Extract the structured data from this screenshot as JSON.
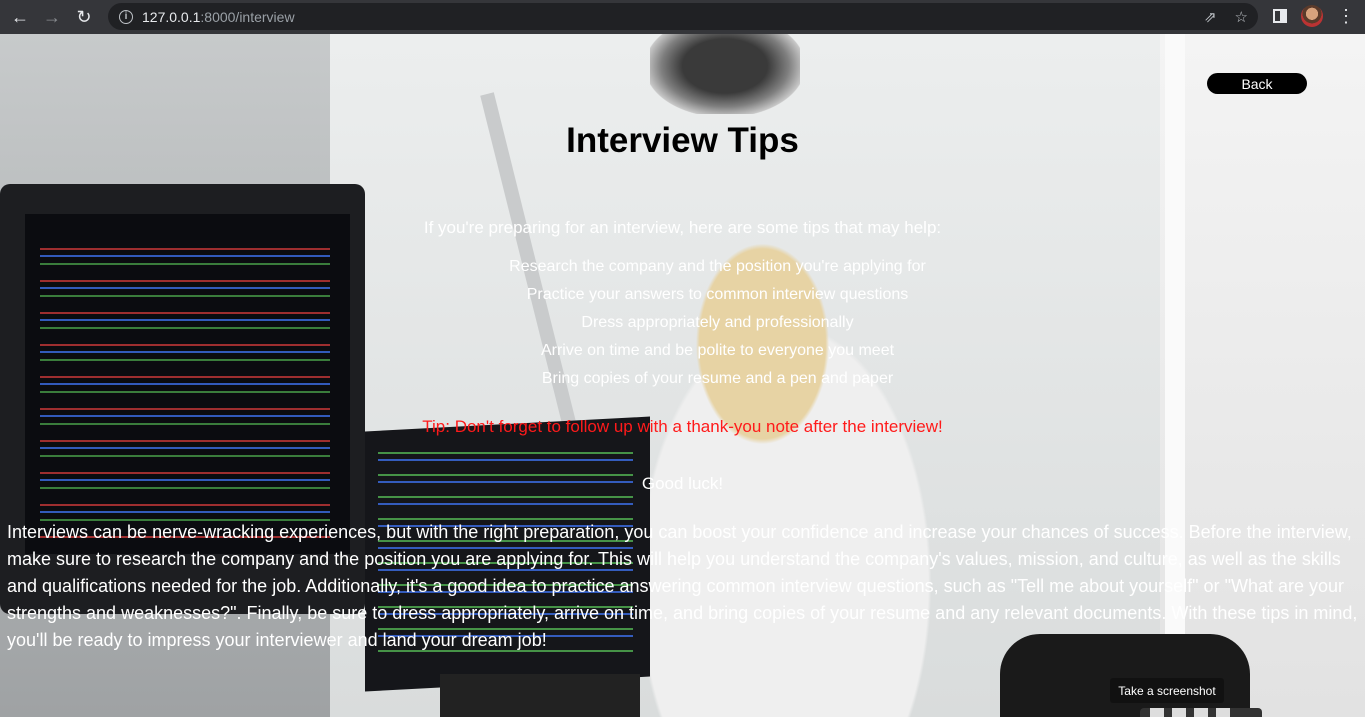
{
  "browser": {
    "url_host": "127.0.0.1",
    "url_path": ":8000/interview",
    "back_glyph": "arrow-left-icon",
    "forward_glyph": "arrow-right-icon",
    "reload_glyph": "reload-icon"
  },
  "page": {
    "back_label": "Back",
    "title": "Interview Tips",
    "intro": "If you're preparing for an interview, here are some tips that may help:",
    "tips": [
      "Research the company and the position you're applying for",
      "Practice your answers to common interview questions",
      "Dress appropriately and professionally",
      "Arrive on time and be polite to everyone you meet",
      "Bring copies of your resume and a pen and paper"
    ],
    "tip_highlight": "Tip: Don't forget to follow up with a thank-you note after the interview!",
    "good_luck": "Good luck!",
    "paragraph": "Interviews can be nerve-wracking experiences, but with the right preparation, you can boost your confidence and increase your chances of success. Before the interview, make sure to research the company and the position you are applying for. This will help you understand the company's values, mission, and culture, as well as the skills and qualifications needed for the job. Additionally, it's a good idea to practice answering common interview questions, such as \"Tell me about yourself\" or \"What are your strengths and weaknesses?\". Finally, be sure to dress appropriately, arrive on time, and bring copies of your resume and any relevant documents. With these tips in mind, you'll be ready to impress your interviewer and land your dream job!"
  },
  "overlay": {
    "tooltip": "Take a screenshot"
  },
  "colors": {
    "tip_red": "#ff1a1a",
    "button_bg": "#000000"
  }
}
